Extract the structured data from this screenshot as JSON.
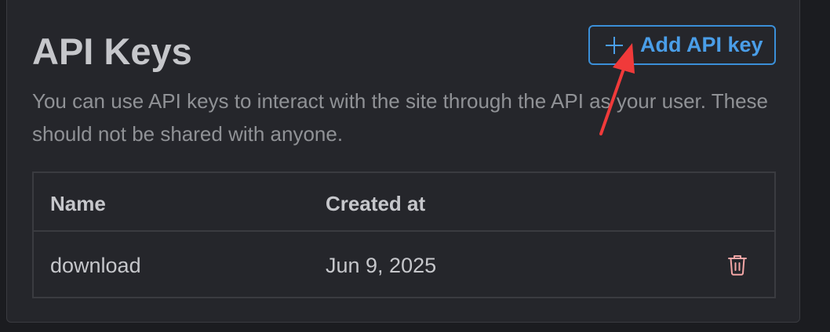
{
  "section": {
    "title": "API Keys",
    "description": "You can use API keys to interact with the site through the API as your user. These should not be shared with anyone."
  },
  "add_button": {
    "label": "Add API key",
    "icon": "plus-icon"
  },
  "table": {
    "columns": [
      "Name",
      "Created at"
    ],
    "rows": [
      {
        "name": "download",
        "created_at": "Jun 9, 2025",
        "action_icon": "trash-icon"
      }
    ]
  },
  "colors": {
    "accent": "#4a9ee8",
    "danger_icon": "#f4a6a6",
    "annotation_arrow": "#f03a3a"
  }
}
